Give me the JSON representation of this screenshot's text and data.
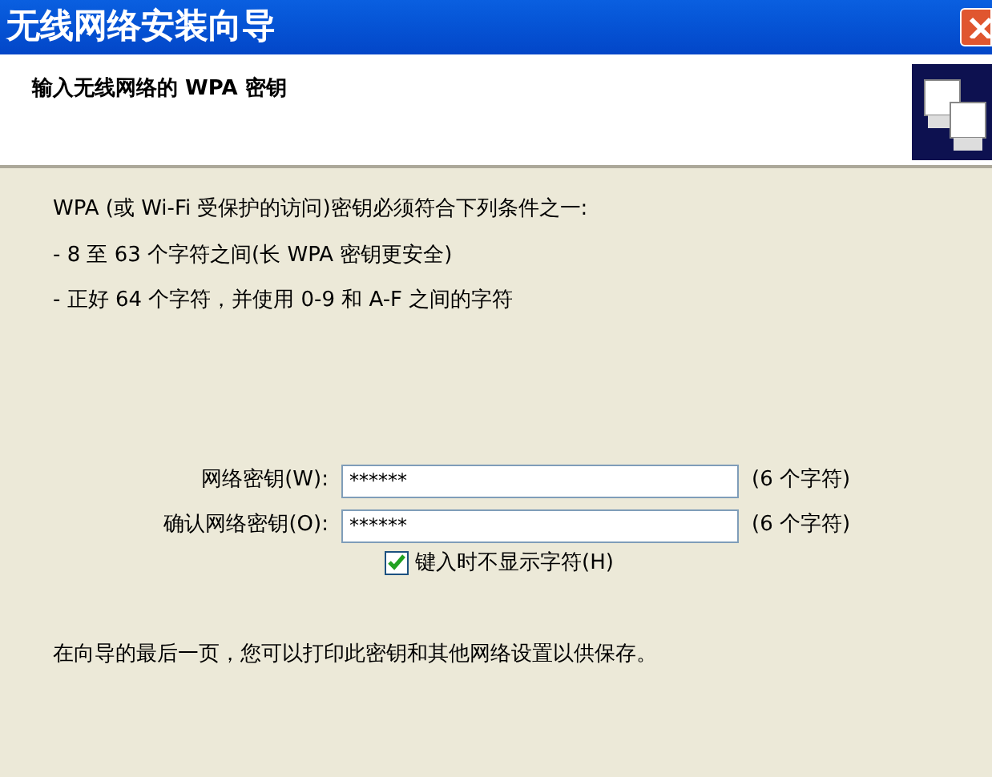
{
  "window": {
    "title": "无线网络安装向导"
  },
  "header": {
    "title": "输入无线网络的 WPA 密钥"
  },
  "intro": [
    "WPA (或 Wi-Fi 受保护的访问)密钥必须符合下列条件之一:",
    "- 8 至 63 个字符之间(长 WPA 密钥更安全)",
    "- 正好 64 个字符，并使用 0-9 和 A-F 之间的字符"
  ],
  "fields": [
    {
      "label": "网络密钥(W):",
      "value": "******",
      "hint": "(6 个字符)"
    },
    {
      "label": "确认网络密钥(O):",
      "value": "******",
      "hint": "(6 个字符)"
    }
  ],
  "hide_characters": {
    "label": "键入时不显示字符(H)",
    "checked": true
  },
  "footer_note": "在向导的最后一页，您可以打印此密钥和其他网络设置以供保存。"
}
